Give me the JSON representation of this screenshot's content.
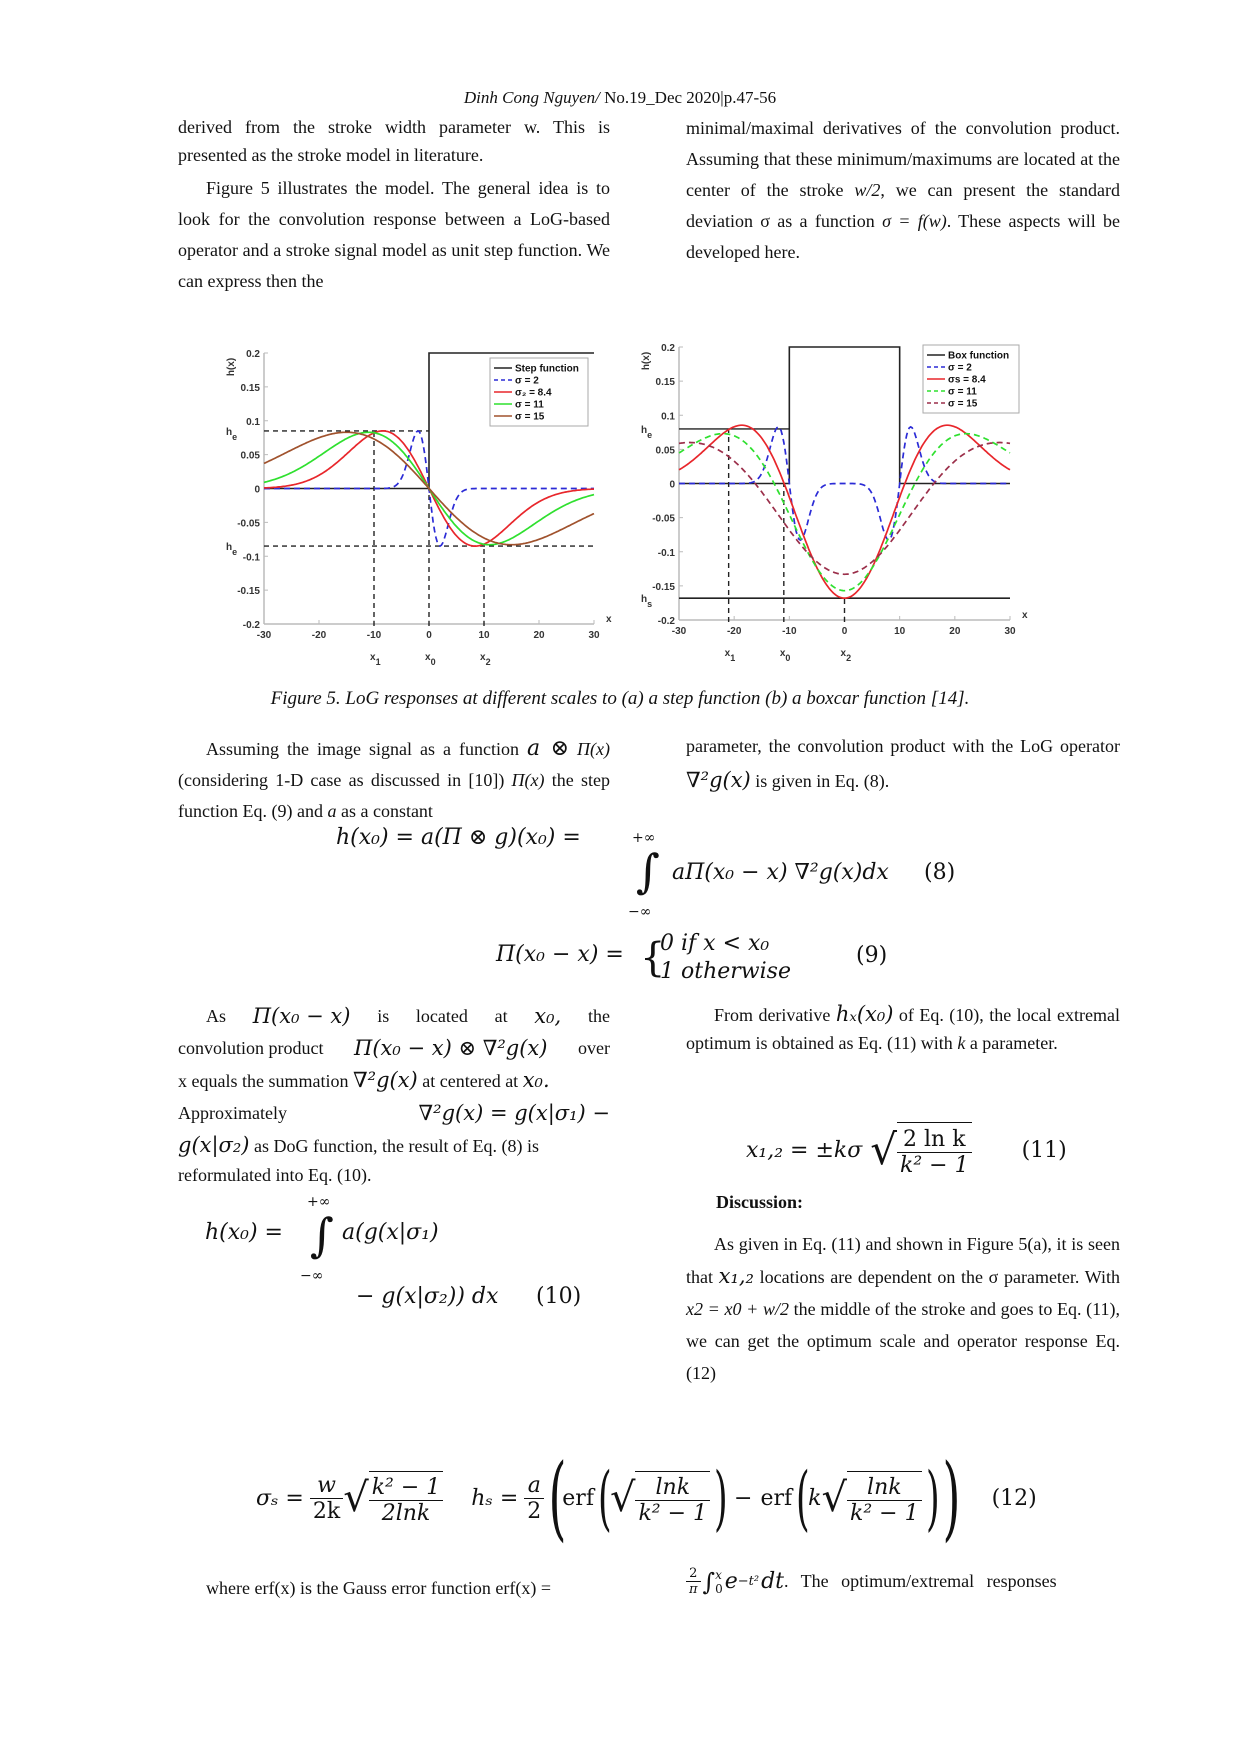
{
  "header": {
    "author": "Dinh Cong Nguyen/",
    "issue": " No.19_Dec 2020|p.47-56"
  },
  "top_left": {
    "p1": "derived from the stroke width parameter w. This is presented as the stroke model in literature.",
    "p2": "Figure 5 illustrates the model. The general idea is to look for the convolution response between a LoG-based operator and a stroke signal model as unit step function. We can express then the"
  },
  "top_right": {
    "p1a": "minimal/maximal derivatives of the convolution product. Assuming that these minimum/maximums are located at the center of the stroke ",
    "p1b": "w/2",
    "p1c": ", we can present the standard deviation σ as a function ",
    "p1d": "σ = f(w)",
    "p1e": ". These aspects will be developed here."
  },
  "figure": {
    "caption": "Figure 5. LoG responses at different scales to (a) a step function (b) a boxcar function [14]."
  },
  "chart_data": [
    {
      "type": "line",
      "panel": "a",
      "title": "",
      "xlabel": "x",
      "ylabel": "h(x)",
      "xlim": [
        -30,
        30
      ],
      "ylim": [
        -0.2,
        0.2
      ],
      "xticks": [
        -30,
        -20,
        -10,
        0,
        10,
        20,
        30
      ],
      "yticks": [
        -0.2,
        -0.15,
        -0.1,
        -0.05,
        0,
        0.05,
        0.1,
        0.15,
        0.2
      ],
      "ytick_labels": [
        "-0.2",
        "-0.15",
        "-0.1",
        "-0.05",
        "0",
        "0.05",
        "0.1",
        "0.15",
        "0.2"
      ],
      "legend_position": "top-right",
      "annotations": {
        "y_marks": [
          {
            "label": "h_e",
            "y": 0.085
          },
          {
            "label": "h_e",
            "y": -0.085
          }
        ],
        "x_marks": [
          {
            "label": "x_1",
            "x": -10
          },
          {
            "label": "x_0",
            "x": 0
          },
          {
            "label": "x_2",
            "x": 10
          }
        ]
      },
      "series": [
        {
          "name": "Step function",
          "color": "#222222",
          "dash": "solid",
          "kind": "step",
          "x0": 0,
          "low": 0,
          "high": 0.2
        },
        {
          "name": "σ = 2",
          "color": "#2b2bd6",
          "dash": "dashed",
          "kind": "dog",
          "sigma": 2,
          "peak": 0.085
        },
        {
          "name": "σ₂ = 8.4",
          "color": "#e8262b",
          "dash": "solid",
          "kind": "dog",
          "sigma": 8.4,
          "peak": 0.085
        },
        {
          "name": "σ = 11",
          "color": "#2fe02f",
          "dash": "solid",
          "kind": "dog",
          "sigma": 11,
          "peak": 0.083
        },
        {
          "name": "σ = 15",
          "color": "#a0522d",
          "dash": "solid",
          "kind": "dog",
          "sigma": 15,
          "peak": 0.083
        }
      ]
    },
    {
      "type": "line",
      "panel": "b",
      "title": "",
      "xlabel": "x",
      "ylabel": "h(x)",
      "xlim": [
        -30,
        30
      ],
      "ylim": [
        -0.2,
        0.2
      ],
      "xticks": [
        -30,
        -20,
        -10,
        0,
        10,
        20,
        30
      ],
      "yticks": [
        -0.2,
        -0.15,
        -0.1,
        -0.05,
        0,
        0.05,
        0.1,
        0.15,
        0.2
      ],
      "ytick_labels": [
        "-0.2",
        "-0.15",
        "-0.1",
        "-0.05",
        "0",
        "0.05",
        "0.1",
        "0.15",
        "0.2"
      ],
      "legend_position": "top-right",
      "annotations": {
        "y_marks": [
          {
            "label": "h_e",
            "y": 0.08
          },
          {
            "label": "h_s",
            "y": -0.168
          }
        ],
        "x_marks": [
          {
            "label": "x_1",
            "x": -21
          },
          {
            "label": "x_0",
            "x": -11
          },
          {
            "label": "x_2",
            "x": 0
          }
        ]
      },
      "series": [
        {
          "name": "Box function",
          "color": "#222222",
          "dash": "solid",
          "kind": "box",
          "from": -10,
          "to": 10,
          "low": 0,
          "high": 0.2
        },
        {
          "name": "σ = 2",
          "color": "#2b2bd6",
          "dash": "dashed",
          "kind": "boxresp",
          "sigma": 2,
          "center": 0,
          "extreme": 0.083
        },
        {
          "name": "σs = 8.4",
          "color": "#e8262b",
          "dash": "solid",
          "kind": "boxresp",
          "sigma": 8.4,
          "center": -0.168,
          "extreme": 0.078
        },
        {
          "name": "σ = 11",
          "color": "#2fe02f",
          "dash": "dashed",
          "kind": "boxresp",
          "sigma": 11,
          "center": -0.157,
          "extreme": 0.07
        },
        {
          "name": "σ = 15",
          "color": "#9b2f4a",
          "dash": "dashed",
          "kind": "boxresp",
          "sigma": 15,
          "center": -0.133,
          "extreme": 0.06
        }
      ]
    }
  ],
  "mid_left": {
    "p1a": "Assuming the image signal as a function ",
    "p1b": "a ⊗",
    "p1c": "Π(x)",
    "p1d": " (considering 1-D case as discussed in [10]) ",
    "p1e": "Π(x)",
    "p1f": " the step function Eq. (9) and ",
    "p1g": "a",
    "p1h": " as a constant"
  },
  "mid_right": {
    "p1a": "parameter, the convolution product with the LoG operator ",
    "p1b": "∇²g(x)",
    "p1c": " is given in Eq. (8)."
  },
  "eq8": {
    "lhs": "h(x₀) = a(Π ⊗ g)(x₀) =",
    "upper": "+∞",
    "lower": "−∞",
    "integrand": "aΠ(x₀ − x) ∇²g(x)dx",
    "number": "(8)"
  },
  "eq9": {
    "lhs": "Π(x₀ − x) =",
    "case1": "0  if x <  x₀",
    "case2": "1  otherwise",
    "number": "(9)"
  },
  "left2": {
    "l1a": "As",
    "l1b": "Π(x₀ − x)",
    "l1c": "is",
    "l1d": "located",
    "l1e": "at",
    "l1f": "x₀,",
    "l1g": "the",
    "l2a": "convolution product ",
    "l2b": "Π(x₀ − x) ⊗ ∇²g(x)",
    "l2c": " over",
    "l3a": "x equals the summation ",
    "l3b": "∇²g(x)",
    "l3c": " at centered at ",
    "l3d": "x₀.",
    "l4a": "Approximately",
    "l4b": "∇²g(x) = g(x|σ₁) −",
    "l5a": "g(x|σ₂)",
    "l5b": " as DoG function, the result of Eq. (8) is",
    "l6": "reformulated into Eq. (10)."
  },
  "eq10": {
    "lhs": "h(x₀) =",
    "upper": "+∞",
    "lower": "−∞",
    "line1": "a(g(x|σ₁)",
    "line2": "− g(x|σ₂)) dx",
    "number": "(10)"
  },
  "right2": {
    "p1a": "From derivative ",
    "p1b": "hₓ(x₀)",
    "p1c": " of Eq. (10), the local extremal optimum is obtained as Eq. (11) with ",
    "p1d": "k",
    "p1e": " a parameter."
  },
  "eq11": {
    "lhs": "x₁,₂ =  ±kσ",
    "num": "2 ln k",
    "den": "k² − 1",
    "number": "(11)"
  },
  "discussion": {
    "heading": "Discussion:",
    "p1a": "As given in Eq. (11) and shown in Figure 5(a), it is seen that ",
    "p1b": "x₁,₂",
    "p1c": " locations are dependent on the σ parameter. With ",
    "p1d": "x2 = x0 + w/2",
    "p1e": " the middle of the stroke and goes to Eq. (11), we can get the optimum scale and operator response Eq. (12)"
  },
  "eq12": {
    "sigma_lhs": "σₛ =",
    "w": "w",
    "twok": "2k",
    "rad_num": "k² − 1",
    "rad_den": "2lnk",
    "h_lhs": "hₛ =",
    "a": "a",
    "two": "2",
    "erf1": "erf",
    "lnk": "lnk",
    "k2m1": "k² − 1",
    "minus": "−",
    "erf2": "erf",
    "k": "k",
    "number": "(12)"
  },
  "bottom": {
    "left": "where erf(x) is the Gauss error function erf(x) =",
    "frac_num": "2",
    "frac_den": "π",
    "integral": "∫",
    "int_upper": "x",
    "int_lower": "0",
    "expr": "e",
    "exp": "−t²",
    "dt": "dt",
    "tail": ". The optimum/extremal responses"
  }
}
